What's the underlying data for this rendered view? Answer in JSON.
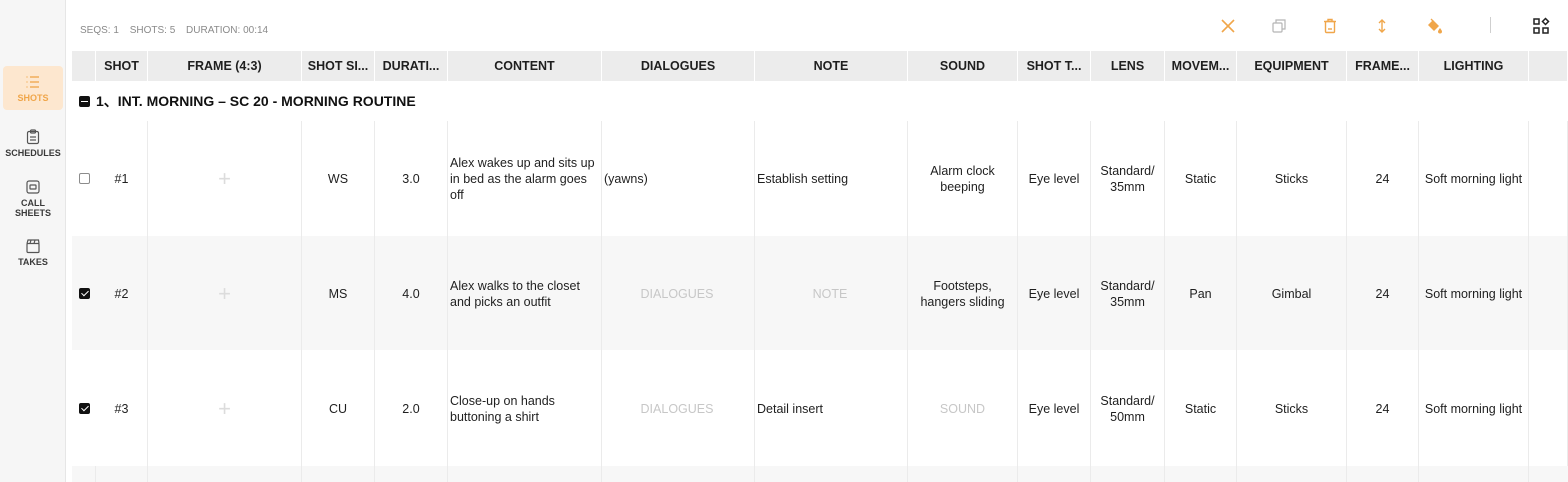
{
  "sidebar": {
    "items": [
      {
        "label": "SHOTS",
        "icon": "list-icon",
        "active": true
      },
      {
        "label": "SCHEDULES",
        "icon": "clipboard-icon",
        "active": false
      },
      {
        "label": "CALL SHEETS",
        "icon": "sheet-icon",
        "active": false
      },
      {
        "label": "TAKES",
        "icon": "clapperboard-icon",
        "active": false
      }
    ]
  },
  "stats": {
    "seqs": "SEQS: 1",
    "shots": "SHOTS: 5",
    "duration": "DURATION: 00:14"
  },
  "toolbar": {
    "icons": [
      "close-icon",
      "duplicate-icon",
      "delete-icon",
      "move-icon",
      "paint-bucket-icon",
      "layout-icon"
    ],
    "accent": "#f0a64a"
  },
  "columns": [
    "SHOT",
    "FRAME (4:3)",
    "SHOT SI...",
    "DURATI...",
    "CONTENT",
    "DIALOGUES",
    "NOTE",
    "SOUND",
    "SHOT T...",
    "LENS",
    "MOVEM...",
    "EQUIPMENT",
    "FRAME...",
    "LIGHTING"
  ],
  "group": {
    "title": "1、INT. MORNING – SC 20 - MORNING ROUTINE"
  },
  "rows": [
    {
      "checked": false,
      "shot": "#1",
      "size": "WS",
      "duration": "3.0",
      "content": "Alex wakes up and sits up in bed as the alarm goes off",
      "dialogues": "(yawns)",
      "dialogues_placeholder": false,
      "note": "Establish setting",
      "note_placeholder": false,
      "sound": "Alarm clock beeping",
      "sound_placeholder": false,
      "shot_type": "Eye level",
      "lens": "Standard/ 35mm",
      "movement": "Static",
      "equipment": "Sticks",
      "frame_rate": "24",
      "lighting": "Soft morning light"
    },
    {
      "checked": true,
      "shot": "#2",
      "size": "MS",
      "duration": "4.0",
      "content": "Alex walks to the closet and picks an outfit",
      "dialogues": "DIALOGUES",
      "dialogues_placeholder": true,
      "note": "NOTE",
      "note_placeholder": true,
      "sound": "Footsteps, hangers sliding",
      "sound_placeholder": false,
      "shot_type": "Eye level",
      "lens": "Standard/ 35mm",
      "movement": "Pan",
      "equipment": "Gimbal",
      "frame_rate": "24",
      "lighting": "Soft morning light"
    },
    {
      "checked": true,
      "shot": "#3",
      "size": "CU",
      "duration": "2.0",
      "content": "Close-up on hands buttoning a shirt",
      "dialogues": "DIALOGUES",
      "dialogues_placeholder": true,
      "note": "Detail insert",
      "note_placeholder": false,
      "sound": "SOUND",
      "sound_placeholder": true,
      "shot_type": "Eye level",
      "lens": "Standard/ 50mm",
      "movement": "Static",
      "equipment": "Sticks",
      "frame_rate": "24",
      "lighting": "Soft morning light"
    }
  ]
}
